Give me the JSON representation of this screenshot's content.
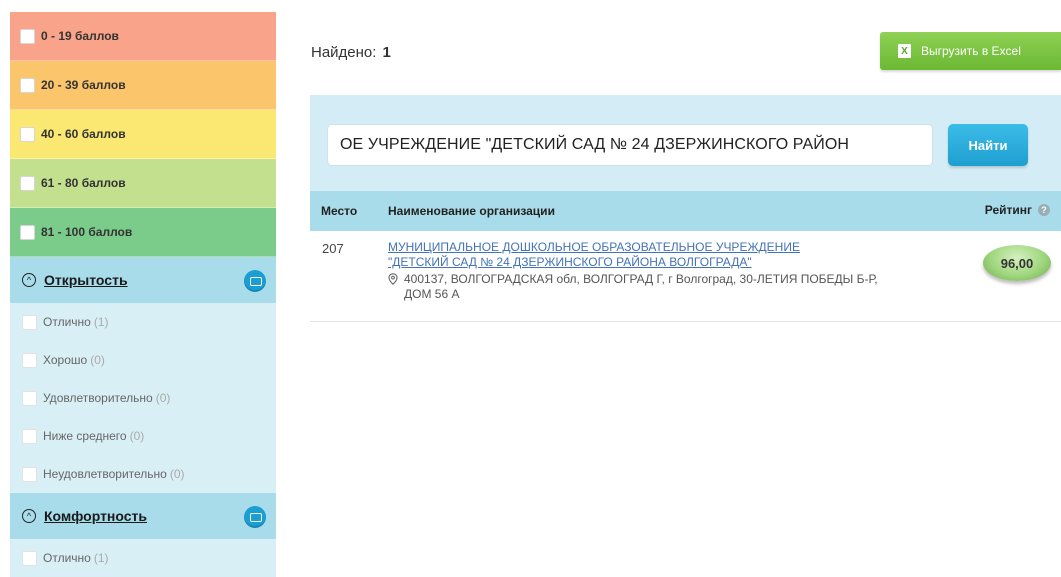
{
  "score_filters": [
    {
      "label": "0 - 19 баллов",
      "color": "#f9a38a"
    },
    {
      "label": "20 - 39 баллов",
      "color": "#fbc56b"
    },
    {
      "label": "40 - 60 баллов",
      "color": "#fae872"
    },
    {
      "label": "61 - 80 баллов",
      "color": "#c3e08f"
    },
    {
      "label": "81 - 100 баллов",
      "color": "#7bcc8a"
    }
  ],
  "sections": [
    {
      "title": "Открытость",
      "items": [
        {
          "label": "Отлично",
          "count": "(1)"
        },
        {
          "label": "Хорошо",
          "count": "(0)"
        },
        {
          "label": "Удовлетворительно",
          "count": "(0)"
        },
        {
          "label": "Ниже среднего",
          "count": "(0)"
        },
        {
          "label": "Неудовлетворительно",
          "count": "(0)"
        }
      ]
    },
    {
      "title": "Комфортность",
      "items": [
        {
          "label": "Отлично",
          "count": "(1)"
        }
      ]
    }
  ],
  "results": {
    "found_label": "Найдено:",
    "found_count": "1"
  },
  "excel_button": {
    "label": "Выгрузить в Excel"
  },
  "search": {
    "value": "ОЕ УЧРЕЖДЕНИЕ \"ДЕТСКИЙ САД № 24 ДЗЕРЖИНСКОГО РАЙОН",
    "button_label": "Найти"
  },
  "table": {
    "headers": {
      "place": "Место",
      "name": "Наименование организации",
      "rating": "Рейтинг"
    },
    "rows": [
      {
        "place": "207",
        "name_line1": "МУНИЦИПАЛЬНОЕ ДОШКОЛЬНОЕ ОБРАЗОВАТЕЛЬНОЕ УЧРЕЖДЕНИЕ",
        "name_line2": "\"ДЕТСКИЙ САД № 24 ДЗЕРЖИНСКОГО РАЙОНА ВОЛГОГРАДА\"",
        "address": "400137, ВОЛГОГРАДСКАЯ обл, ВОЛГОГРАД Г, г Волгоград, 30-ЛЕТИЯ ПОБЕДЫ Б-Р, ДОМ 56 А",
        "rating": "96,00"
      }
    ]
  },
  "icons": {
    "section_icon": "monitor-icon",
    "excel_icon": "excel-icon",
    "pin_icon": "map-pin-icon",
    "help_icon": "question-icon"
  }
}
